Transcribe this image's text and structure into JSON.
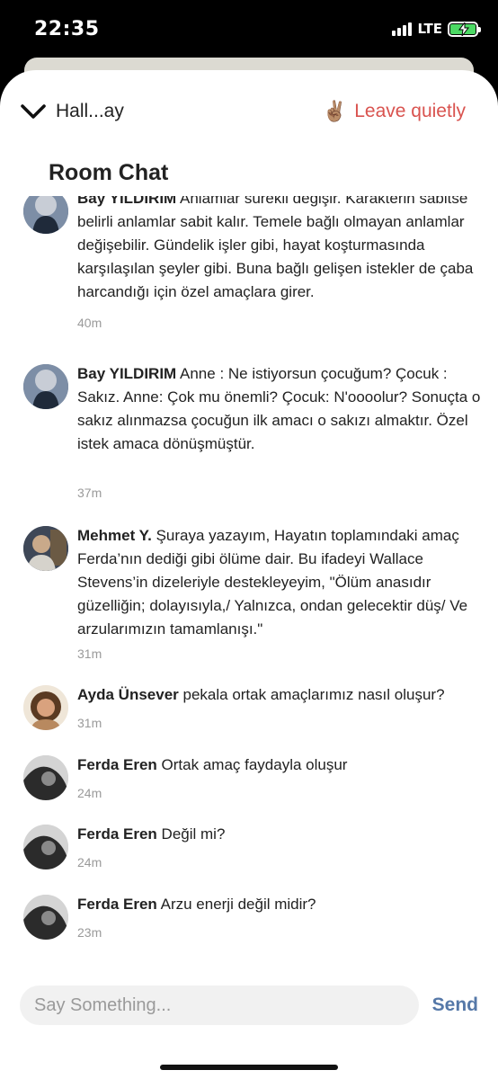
{
  "status_bar": {
    "time": "22:35",
    "network": "LTE",
    "battery_level": 1.0,
    "battery_color": "#4cd964"
  },
  "header": {
    "collapse_icon": "chevron-down-icon",
    "room_name": "Hall...ay",
    "leave_emoji": "✌🏽",
    "leave_label": "Leave quietly",
    "leave_color": "#d9534f"
  },
  "chat": {
    "title": "Room Chat",
    "messages": [
      {
        "author": "Bay YILDIRIM",
        "text": "Anlamlar sürekli değişir. Karakterin sabitse belirli anlamlar sabit kalır. Temele bağlı olmayan anlamlar değişebilir. Gündelik işler gibi, hayat koşturmasında karşılaşılan şeyler gibi. Buna bağlı gelişen istekler de çaba harcandığı için özel amaçlara girer.",
        "time": "40m"
      },
      {
        "author": "Bay YILDIRIM",
        "text": "Anne : Ne istiyorsun çocuğum? Çocuk : Sakız. Anne: Çok mu önemli? Çocuk: N'oooolur?     Sonuçta o sakız alınmazsa çocuğun ilk amacı o sakızı almaktır. Özel istek amaca dönüşmüştür.",
        "time": "37m"
      },
      {
        "author": "Mehmet Y.",
        "text": "Şuraya yazayım, Hayatın toplamındaki amaç Ferda’nın dediği gibi ölüme dair. Bu ifadeyi Wallace Stevens’in dizeleriyle destekleyeyim, \"Ölüm anasıdır güzelliğin; dolayısıyla,/ Yalnızca, ondan gelecektir düş/ Ve arzularımızın tamamlanışı.\"",
        "time": "31m"
      },
      {
        "author": "Ayda Ünsever",
        "text": "pekala ortak amaçlarımız nasıl oluşur?",
        "time": "31m"
      },
      {
        "author": "Ferda Eren",
        "text": "Ortak amaç faydayla oluşur",
        "time": "24m"
      },
      {
        "author": "Ferda Eren",
        "text": "Değil mi?",
        "time": "24m"
      },
      {
        "author": "Ferda Eren",
        "text": "Arzu enerji değil midir?",
        "time": "23m"
      }
    ]
  },
  "composer": {
    "placeholder": "Say Something...",
    "value": "",
    "send_label": "Send",
    "send_color": "#5578a8"
  }
}
